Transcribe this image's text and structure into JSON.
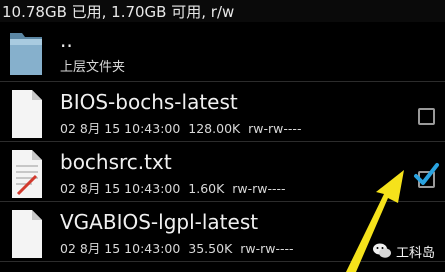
{
  "status": {
    "text": "10.78GB 已用, 1.70GB 可用, r/w"
  },
  "parent": {
    "name": "..",
    "label": "上层文件夹",
    "icon": "folder-icon"
  },
  "files": [
    {
      "name": "BIOS-bochs-latest",
      "date": "02 8月 15 10:43:00",
      "size": "128.00K",
      "perms": "rw-rw----",
      "icon": "file-icon",
      "checked": false
    },
    {
      "name": "bochsrc.txt",
      "date": "02 8月 15 10:43:00",
      "size": "1.60K",
      "perms": "rw-rw----",
      "icon": "text-file-icon",
      "checked": true
    },
    {
      "name": "VGABIOS-lgpl-latest",
      "date": "02 8月 15 10:43:00",
      "size": "35.50K",
      "perms": "rw-rw----",
      "icon": "file-icon",
      "checked": false
    }
  ],
  "annotation": {
    "icon": "arrow-icon",
    "color": "#f5e21b"
  },
  "watermark": {
    "text": "工科岛",
    "icon": "wechat-icon"
  },
  "colors": {
    "check": "#2aa3e0",
    "background": "#000000"
  }
}
